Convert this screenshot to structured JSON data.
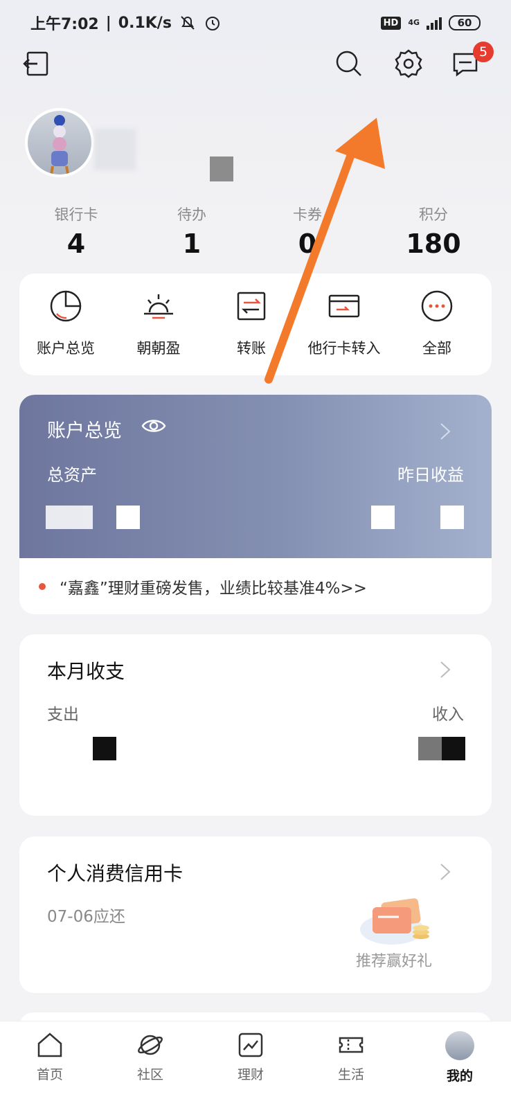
{
  "status_bar": {
    "time": "上午7:02",
    "speed": "0.1K/s",
    "hd": "HD",
    "network": "4G",
    "battery": "60"
  },
  "header": {
    "icons": [
      "logout-icon",
      "search-icon",
      "gear-icon",
      "message-icon"
    ],
    "message_badge": "5"
  },
  "stats": [
    {
      "label": "银行卡",
      "value": "4"
    },
    {
      "label": "待办",
      "value": "1"
    },
    {
      "label": "卡券",
      "value": "0"
    },
    {
      "label": "积分",
      "value": "180"
    }
  ],
  "quick_actions": [
    {
      "label": "账户总览",
      "icon": "pie-chart-icon"
    },
    {
      "label": "朝朝盈",
      "icon": "sunrise-icon"
    },
    {
      "label": "转账",
      "icon": "transfer-icon"
    },
    {
      "label": "他行卡转入",
      "icon": "card-in-icon"
    },
    {
      "label": "全部",
      "icon": "more-icon"
    }
  ],
  "account": {
    "title": "账户总览",
    "total_label": "总资产",
    "yesterday_label": "昨日收益",
    "promo": "“嘉鑫”理财重磅发售，业绩比较基准4%>>"
  },
  "monthly": {
    "title": "本月收支",
    "expense_label": "支出",
    "income_label": "收入"
  },
  "credit": {
    "title": "个人消费信用卡",
    "due_label": "07-06应还",
    "recommend": "推荐赢好礼"
  },
  "nav": [
    {
      "label": "首页",
      "icon": "home-icon"
    },
    {
      "label": "社区",
      "icon": "planet-icon"
    },
    {
      "label": "理财",
      "icon": "chart-icon"
    },
    {
      "label": "生活",
      "icon": "ticket-icon"
    },
    {
      "label": "我的",
      "icon": "avatar"
    }
  ],
  "colors": {
    "accent_red": "#e63b2e",
    "arrow_orange": "#f47a2b",
    "account_card_start": "#6e769e",
    "account_card_end": "#a3b1cd"
  }
}
